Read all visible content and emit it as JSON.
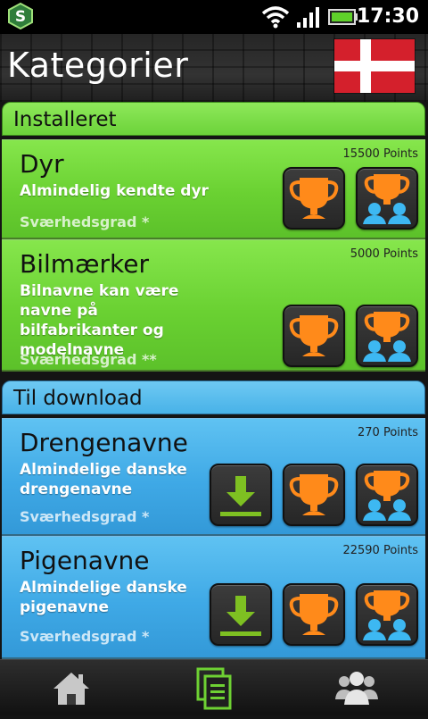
{
  "status_bar": {
    "time": "17:30",
    "app_badge_letter": "S",
    "icons": [
      "app-badge-icon",
      "wifi-icon",
      "signal-icon",
      "battery-icon"
    ]
  },
  "header": {
    "title": "Kategorier",
    "flag": "danish-flag-icon"
  },
  "sections": [
    {
      "label": "Installeret",
      "color": "#7ddc45",
      "cards": [
        {
          "title": "Dyr",
          "points": "15500 Points",
          "description": "Almindelig kendte dyr",
          "difficulty": "Sværhedsgrad *",
          "buttons": [
            "trophy-icon",
            "multiplayer-trophy-icon"
          ]
        },
        {
          "title": "Bilmærker",
          "points": "5000 Points",
          "description": "Bilnavne kan være navne på bilfabrikanter og modelnavne",
          "difficulty": "Sværhedsgrad **",
          "buttons": [
            "trophy-icon",
            "multiplayer-trophy-icon"
          ]
        }
      ]
    },
    {
      "label": "Til download",
      "color": "#4db3ea",
      "cards": [
        {
          "title": "Drengenavne",
          "points": "270 Points",
          "description": "Almindelige danske drengenavne",
          "difficulty": "Sværhedsgrad *",
          "buttons": [
            "download-icon",
            "trophy-icon",
            "multiplayer-trophy-icon"
          ]
        },
        {
          "title": "Pigenavne",
          "points": "22590 Points",
          "description": "Almindelige danske pigenavne",
          "difficulty": "Sværhedsgrad *",
          "buttons": [
            "download-icon",
            "trophy-icon",
            "multiplayer-trophy-icon"
          ]
        }
      ]
    }
  ],
  "bottom_nav": {
    "items": [
      "home-icon",
      "categories-icon",
      "people-icon"
    ],
    "active": "categories-icon"
  },
  "colors": {
    "trophy": "#ff8a1a",
    "players": "#3db8f2",
    "download": "#7ec022",
    "active_nav": "#6ed133"
  }
}
